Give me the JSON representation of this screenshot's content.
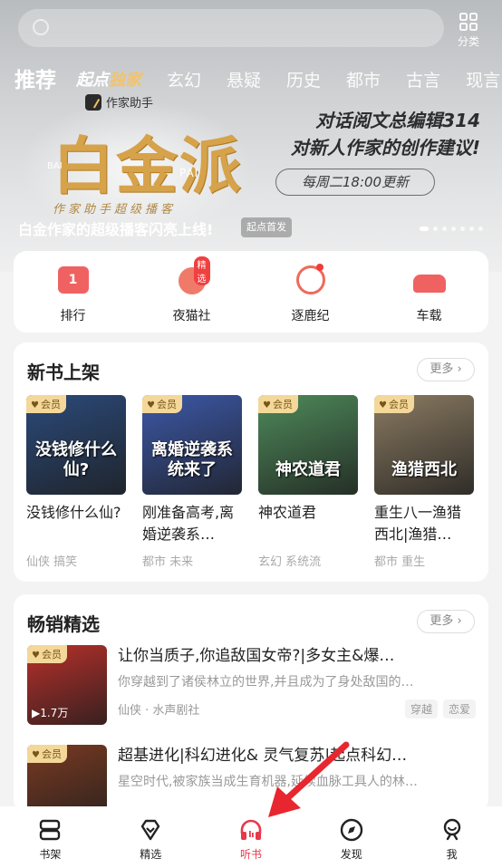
{
  "header": {
    "category_label": "分类",
    "tabs": [
      {
        "label": "推荐",
        "active": true
      },
      {
        "label_a": "起点",
        "label_b": "独家",
        "special": true
      },
      {
        "label": "玄幻"
      },
      {
        "label": "悬疑"
      },
      {
        "label": "历史"
      },
      {
        "label": "都市"
      },
      {
        "label": "古言"
      },
      {
        "label": "现言"
      }
    ]
  },
  "banner": {
    "assistant_label": "作家助手",
    "big_title": "白金派",
    "pai_text": "PAI",
    "bai_text": "BAI",
    "subtitle": "作家助手超级播客",
    "headline_line1": "对话阅文总编辑314",
    "headline_line2": "对新人作家的创作建议!",
    "weekly_label": "每周二18:00更新",
    "caption": "白金作家的超级播客闪亮上线!",
    "first_tag": "起点首发",
    "page_count": 7,
    "active_page": 0
  },
  "shortcuts": [
    {
      "label": "排行",
      "icon": "rank-icon",
      "badge_text": "1"
    },
    {
      "label": "夜猫社",
      "icon": "night-cat-icon",
      "badge": "精选"
    },
    {
      "label": "逐鹿纪",
      "icon": "deer-icon",
      "has_dot": true
    },
    {
      "label": "车载",
      "icon": "car-icon"
    }
  ],
  "new_books": {
    "title": "新书上架",
    "more": "更多",
    "items": [
      {
        "vip": "会员",
        "title": "没钱修什么仙?",
        "tags": "仙侠  搞笑",
        "cover_color": "#2b4a7a",
        "cover_text": "没钱修什么仙?"
      },
      {
        "vip": "会员",
        "title": "刚准备高考,离婚逆袭系…",
        "tags": "都市  未来",
        "cover_color": "#3c58a8",
        "cover_text": "离婚逆袭系统来了"
      },
      {
        "vip": "会员",
        "title": "神农道君",
        "tags": "玄幻  系统流",
        "cover_color": "#4e8a5a",
        "cover_text": "神农道君"
      },
      {
        "vip": "会员",
        "title": "重生八一渔猎西北|渔猎…",
        "tags": "都市  重生",
        "cover_color": "#8b7b62",
        "cover_text": "渔猎西北"
      }
    ]
  },
  "bestsellers": {
    "title": "畅销精选",
    "more": "更多",
    "items": [
      {
        "vip": "会员",
        "title": "让你当质子,你追敌国女帝?|多女主&爆…",
        "desc": "你穿越到了诸侯林立的世界,并且成为了身处敌国的…",
        "meta": "仙侠 · 水声剧社",
        "plays": "1.7万",
        "chips": [
          "穿越",
          "恋爱"
        ],
        "cover_color": "#b8302b"
      },
      {
        "vip": "会员",
        "title": "超基进化|科幻进化& 灵气复苏|起点科幻…",
        "desc": "星空时代,被家族当成生育机器,延续血脉工具人的林…",
        "cover_color": "#7a3a22"
      }
    ]
  },
  "bottom_nav": [
    {
      "label": "书架",
      "icon": "bookshelf-icon"
    },
    {
      "label": "精选",
      "icon": "diamond-icon"
    },
    {
      "label": "听书",
      "icon": "headphones-icon",
      "active": true
    },
    {
      "label": "发现",
      "icon": "compass-icon"
    },
    {
      "label": "我",
      "icon": "profile-icon"
    }
  ],
  "colors": {
    "accent": "#e8384a",
    "banner_gold": "#d6a24a",
    "arrow": "#e8262f"
  }
}
